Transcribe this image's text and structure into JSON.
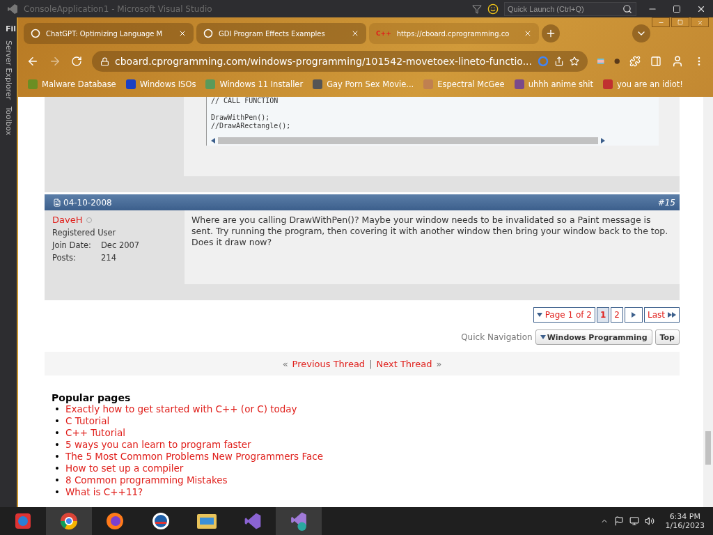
{
  "ide": {
    "title": "ConsoleApplication1 - Microsoft Visual Studio",
    "quick_launch": {
      "placeholder": "Quick Launch (Ctrl+Q)"
    },
    "menu_stub": "Fil",
    "side_tabs": [
      "Server Explorer",
      "Toolbox"
    ]
  },
  "browser": {
    "tabs": [
      {
        "label": "ChatGPT: Optimizing Language M",
        "kind": "chat",
        "selected": false
      },
      {
        "label": "GDI Program Effects Examples",
        "kind": "chat",
        "selected": false
      },
      {
        "label": "https://cboard.cprogramming.co",
        "kind": "cpp",
        "icon_text": "C++",
        "selected": true
      }
    ],
    "url": "cboard.cprogramming.com/windows-programming/101542-movetoex-lineto-functio...",
    "bookmarks": [
      {
        "label": "Malware Database",
        "color": "#6b8e23"
      },
      {
        "label": "Windows ISOs",
        "color": "#1a3fc4"
      },
      {
        "label": "Windows 11 Installer",
        "color": "#5a9a5a"
      },
      {
        "label": "Gay Porn Sex Movie...",
        "color": "#555555"
      },
      {
        "label": "Espectral McGee",
        "color": "#c08050"
      },
      {
        "label": "uhhh anime shit",
        "color": "#7a4a8a"
      },
      {
        "label": "you are an idiot!",
        "color": "#c03030"
      }
    ]
  },
  "page": {
    "code_blocks": [
      [
        "// CALL FUNCTION"
      ],
      [
        "DrawWithPen();",
        "//DrawARectangle();"
      ]
    ],
    "post": {
      "date": "04-10-2008",
      "number": "#15",
      "author": "DaveH",
      "online": false,
      "role": "Registered User",
      "stats": [
        {
          "label": "Join Date:",
          "value": "Dec 2007"
        },
        {
          "label": "Posts:",
          "value": "214"
        }
      ],
      "message": "Where are you calling DrawWithPen()? Maybe your window needs to be invalidated so a Paint message is sent. Try running the program, then covering it with another window then bring your window back to the top. Does it draw now?"
    },
    "pagination": {
      "label": "Page 1 of 2",
      "pages": [
        {
          "label": "1",
          "selected": true
        },
        {
          "label": "2",
          "selected": false
        }
      ],
      "last": "Last"
    },
    "quick_nav": {
      "label": "Quick Navigation",
      "forum": "Windows Programming",
      "top": "Top"
    },
    "thread_nav": {
      "open": "«",
      "prev": "Previous Thread",
      "separator": "|",
      "next": "Next Thread",
      "close": "»"
    },
    "popular": {
      "title": "Popular pages",
      "bullet": "•",
      "links": [
        "Exactly how to get started with C++ (or C) today",
        "C Tutorial",
        "C++ Tutorial",
        "5 ways you can learn to program faster",
        "The 5 Most Common Problems New Programmers Face",
        "How to set up a compiler",
        "8 Common programming Mistakes",
        "What is C++11?"
      ]
    }
  },
  "taskbar": {
    "time": "6:34 PM",
    "date": "1/16/2023"
  }
}
